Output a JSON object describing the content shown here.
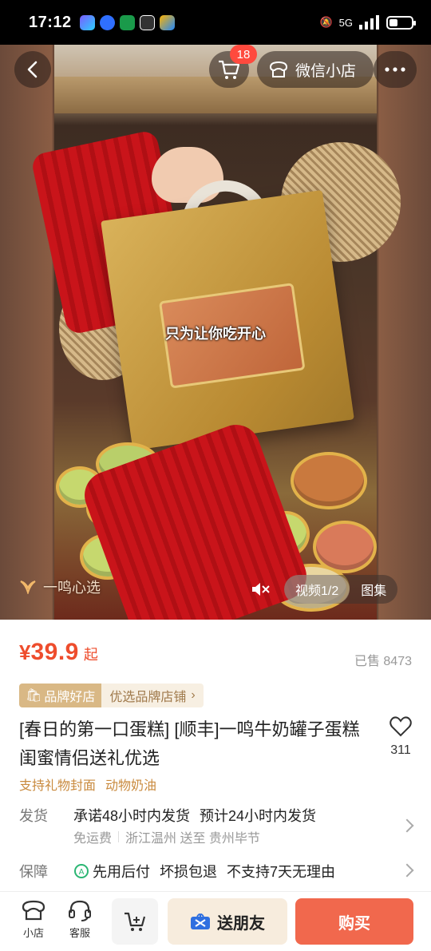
{
  "status_bar": {
    "time": "17:12",
    "network": "5G"
  },
  "header": {
    "cart_badge": "18",
    "shop_label": "微信小店"
  },
  "media": {
    "caption": "只为让你吃开心",
    "watermark": "一鸣心选",
    "tabs": [
      {
        "label": "视频1/2",
        "active": true
      },
      {
        "label": "图集",
        "active": false
      }
    ]
  },
  "product": {
    "price_symbol": "¥",
    "price": "39.9",
    "price_suffix": "起",
    "sold": "已售 8473",
    "brand_tag": "品牌好店",
    "brand_link": "优选品牌店铺",
    "title": "[春日的第一口蛋糕] [顺丰]一鸣牛奶罐子蛋糕 闺蜜情侣送礼优选",
    "favorite_count": "311",
    "features": [
      "支持礼物封面",
      "动物奶油"
    ]
  },
  "shipping": {
    "label": "发货",
    "promise": "承诺48小时内发货",
    "estimate": "预计24小时内发货",
    "fee": "免运费",
    "route": "浙江温州 送至 贵州毕节"
  },
  "guarantee": {
    "label": "保障",
    "items": [
      "先用后付",
      "坏损包退",
      "不支持7天无理由"
    ]
  },
  "bottom_bar": {
    "shop": "小店",
    "service": "客服",
    "share": "送朋友",
    "buy": "购买"
  },
  "colors": {
    "price": "#ee4d2d",
    "buy": "#f1684d",
    "share_bg": "#f7ecdd",
    "brand": "#d9b885"
  }
}
